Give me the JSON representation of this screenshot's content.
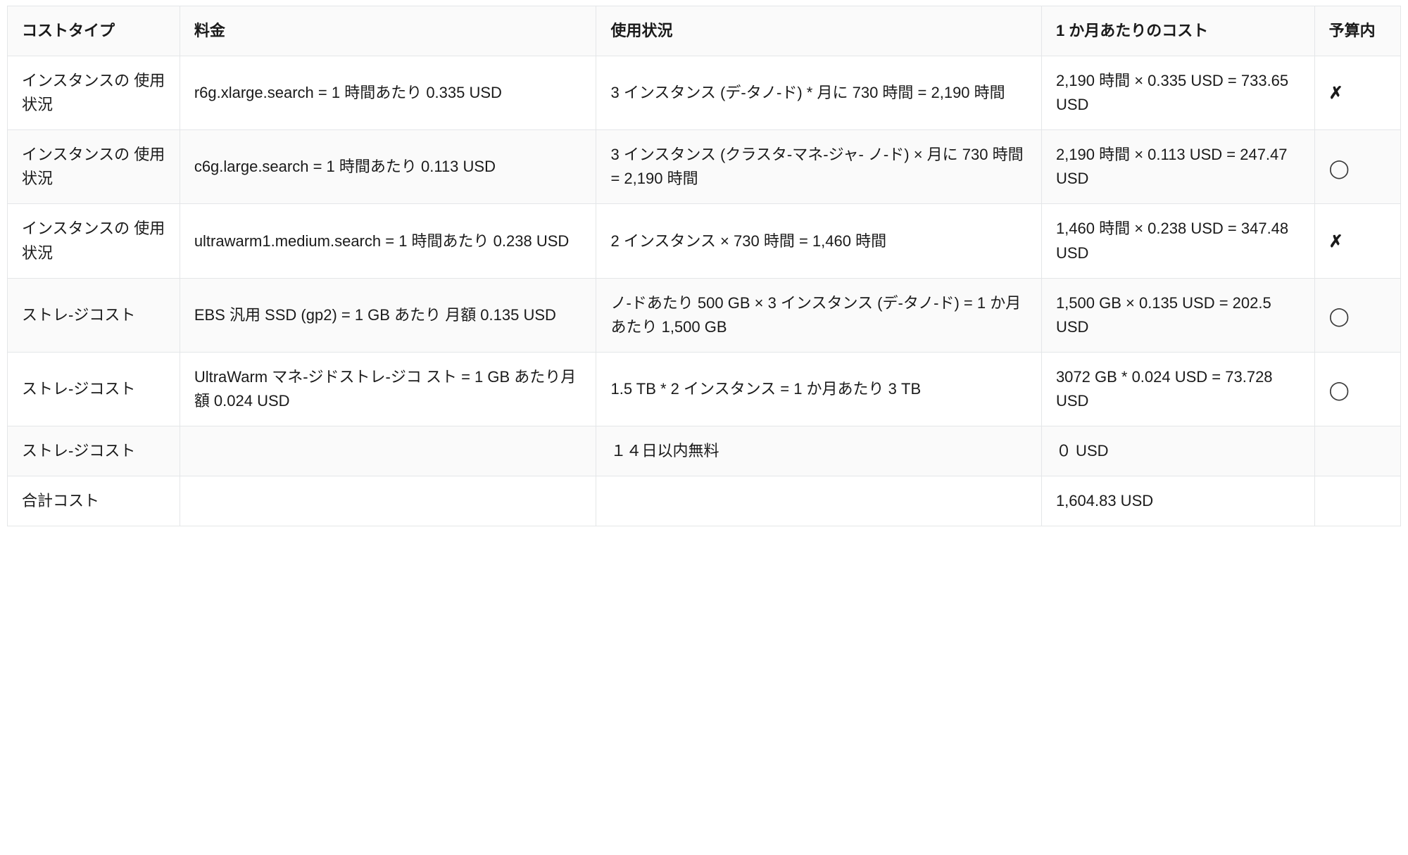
{
  "headers": {
    "cost_type": "コストタイプ",
    "price": "料金",
    "usage": "使用状況",
    "monthly": "1 か月あたりのコスト",
    "budget": "予算内"
  },
  "status_glyphs": {
    "x": "✗",
    "circle": "◯"
  },
  "rows": [
    {
      "cost_type": "インスタンスの 使用状況",
      "price": "r6g.xlarge.search = 1 時間あたり 0.335 USD",
      "usage": "3 インスタンス (デ-タノ-ド) * 月に  730 時間 = 2,190 時間",
      "monthly": "2,190 時間 × 0.335 USD = 733.65 USD",
      "budget": "x"
    },
    {
      "cost_type": "インスタンスの 使用状況",
      "price": "c6g.large.search = 1 時間あたり 0.113 USD",
      "usage": "3 インスタンス (クラスタ-マネ-ジャ- ノ-ド) × 月に 730 時間 = 2,190 時間",
      "monthly": "2,190 時間 × 0.113 USD = 247.47 USD",
      "budget": "circle"
    },
    {
      "cost_type": "インスタンスの 使用状況",
      "price": "ultrawarm1.medium.search = 1 時間あたり 0.238 USD",
      "usage": "2 インスタンス × 730 時間 = 1,460 時間",
      "monthly": "1,460 時間 × 0.238 USD = 347.48 USD",
      "budget": "x"
    },
    {
      "cost_type": "ストレ-ジコスト",
      "price": "EBS 汎用 SSD (gp2) = 1 GB あたり 月額 0.135 USD",
      "usage": "ノ-ドあたり 500 GB × 3 インスタンス (デ-タノ-ド) = 1 か月あたり 1,500 GB",
      "monthly": "1,500 GB × 0.135 USD = 202.5 USD",
      "budget": "circle"
    },
    {
      "cost_type": "ストレ-ジコスト",
      "price": "UltraWarm マネ-ジドストレ-ジコ スト = 1 GB あたり月額 0.024 USD",
      "usage": "1.5 TB * 2 インスタンス = 1 か月あたり 3 TB",
      "monthly": "3072 GB * 0.024 USD  = 73.728 USD",
      "budget": "circle"
    },
    {
      "cost_type": "ストレ-ジコスト",
      "price": "",
      "usage": "１４日以内無料",
      "monthly": "０ USD",
      "budget": ""
    },
    {
      "cost_type": "合計コスト",
      "price": "",
      "usage": "",
      "monthly": "1,604.83 USD",
      "budget": ""
    }
  ]
}
